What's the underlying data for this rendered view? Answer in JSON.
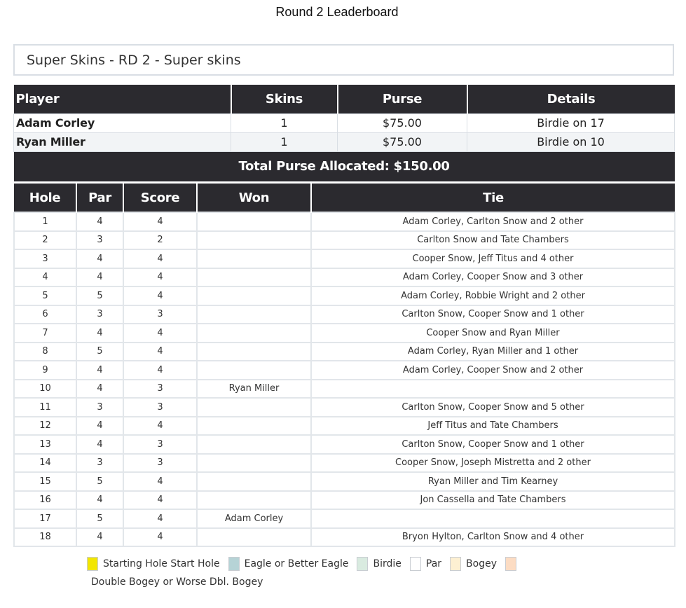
{
  "page_title": "Round 2 Leaderboard",
  "section_title": "Super Skins - RD 2 - Super skins",
  "purse_table": {
    "headers": [
      "Player",
      "Skins",
      "Purse",
      "Details"
    ],
    "rows": [
      {
        "player": "Adam Corley",
        "skins": "1",
        "purse": "$75.00",
        "details": "Birdie on 17"
      },
      {
        "player": "Ryan Miller",
        "skins": "1",
        "purse": "$75.00",
        "details": "Birdie on 10"
      }
    ],
    "total": "Total Purse Allocated: $150.00"
  },
  "holes_table": {
    "headers": [
      "Hole",
      "Par",
      "Score",
      "Won",
      "Tie"
    ],
    "rows": [
      {
        "hole": "1",
        "par": "4",
        "score": "4",
        "won": "",
        "tie": "Adam Corley, Carlton Snow and 2 other"
      },
      {
        "hole": "2",
        "par": "3",
        "score": "2",
        "won": "",
        "tie": "Carlton Snow and Tate Chambers"
      },
      {
        "hole": "3",
        "par": "4",
        "score": "4",
        "won": "",
        "tie": "Cooper Snow, Jeff Titus and 4 other"
      },
      {
        "hole": "4",
        "par": "4",
        "score": "4",
        "won": "",
        "tie": "Adam Corley, Cooper Snow and 3 other"
      },
      {
        "hole": "5",
        "par": "5",
        "score": "4",
        "won": "",
        "tie": "Adam Corley, Robbie Wright and 2 other"
      },
      {
        "hole": "6",
        "par": "3",
        "score": "3",
        "won": "",
        "tie": "Carlton Snow, Cooper Snow and 1 other"
      },
      {
        "hole": "7",
        "par": "4",
        "score": "4",
        "won": "",
        "tie": "Cooper Snow and Ryan Miller"
      },
      {
        "hole": "8",
        "par": "5",
        "score": "4",
        "won": "",
        "tie": "Adam Corley, Ryan Miller and 1 other"
      },
      {
        "hole": "9",
        "par": "4",
        "score": "4",
        "won": "",
        "tie": "Adam Corley, Cooper Snow and 2 other"
      },
      {
        "hole": "10",
        "par": "4",
        "score": "3",
        "won": "Ryan Miller",
        "tie": ""
      },
      {
        "hole": "11",
        "par": "3",
        "score": "3",
        "won": "",
        "tie": "Carlton Snow, Cooper Snow and 5 other"
      },
      {
        "hole": "12",
        "par": "4",
        "score": "4",
        "won": "",
        "tie": "Jeff Titus and Tate Chambers"
      },
      {
        "hole": "13",
        "par": "4",
        "score": "3",
        "won": "",
        "tie": "Carlton Snow, Cooper Snow and 1 other"
      },
      {
        "hole": "14",
        "par": "3",
        "score": "3",
        "won": "",
        "tie": "Cooper Snow, Joseph Mistretta and 2 other"
      },
      {
        "hole": "15",
        "par": "5",
        "score": "4",
        "won": "",
        "tie": "Ryan Miller and Tim Kearney"
      },
      {
        "hole": "16",
        "par": "4",
        "score": "4",
        "won": "",
        "tie": "Jon Cassella and Tate Chambers"
      },
      {
        "hole": "17",
        "par": "5",
        "score": "4",
        "won": "Adam Corley",
        "tie": ""
      },
      {
        "hole": "18",
        "par": "4",
        "score": "4",
        "won": "",
        "tie": "Bryon Hylton, Carlton Snow and 4 other"
      }
    ]
  },
  "legend": [
    {
      "label": "Starting Hole Start Hole",
      "color": "#f2e600"
    },
    {
      "label": "Eagle or Better Eagle",
      "color": "#b6d3d6"
    },
    {
      "label": "Birdie",
      "color": "#d9ebe0"
    },
    {
      "label": "Par",
      "color": "#ffffff"
    },
    {
      "label": "Bogey",
      "color": "#fdf0d2"
    },
    {
      "label": "Double Bogey or Worse Dbl. Bogey",
      "color": "#fcdcc3"
    }
  ]
}
